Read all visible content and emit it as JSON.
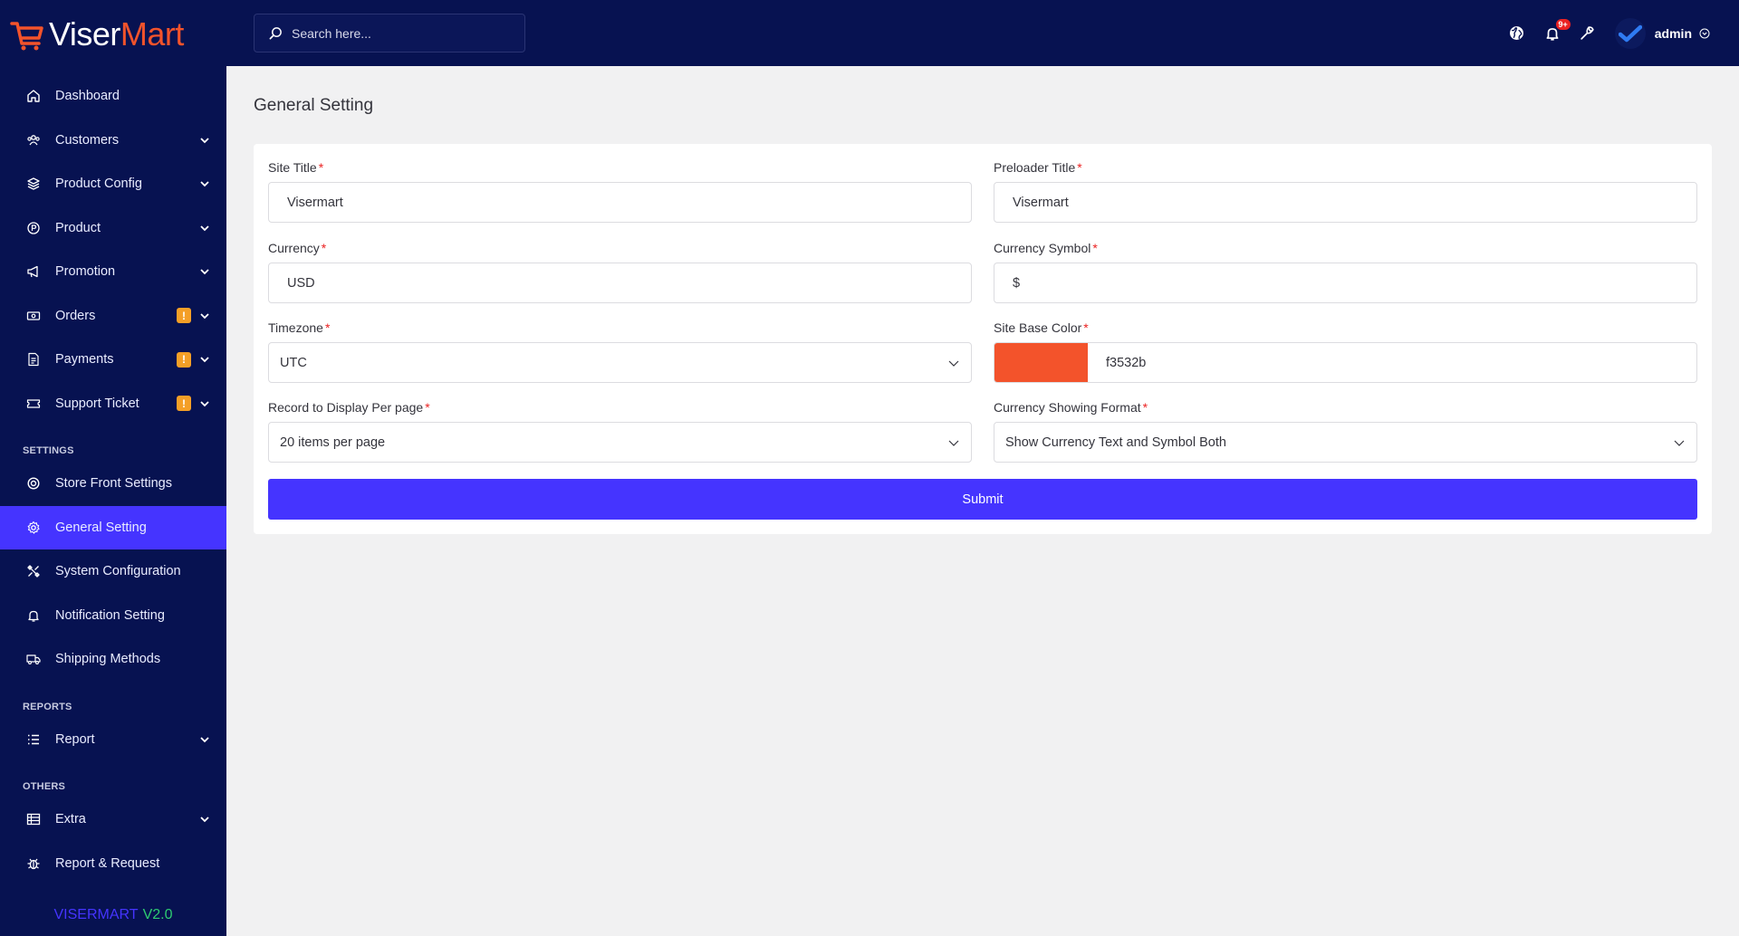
{
  "brand": {
    "logo_part1": "Viser",
    "logo_part2": "Mart",
    "version_name": "VISERMART",
    "version_number": "V2.0",
    "accent": "#4534ff",
    "brand_orange": "#f3532b",
    "sidebar_bg": "#071251"
  },
  "topbar": {
    "search_placeholder": "Search here...",
    "notification_count": "9+",
    "admin_name": "admin"
  },
  "sidebar": {
    "items": [
      {
        "label": "Dashboard",
        "icon": "home-icon"
      },
      {
        "label": "Customers",
        "icon": "users-icon",
        "has_submenu": true
      },
      {
        "label": "Product Config",
        "icon": "config-icon",
        "has_submenu": true
      },
      {
        "label": "Product",
        "icon": "product-icon",
        "has_submenu": true
      },
      {
        "label": "Promotion",
        "icon": "megaphone-icon",
        "has_submenu": true
      },
      {
        "label": "Orders",
        "icon": "money-icon",
        "has_submenu": true,
        "badge": "!"
      },
      {
        "label": "Payments",
        "icon": "invoice-icon",
        "has_submenu": true,
        "badge": "!"
      },
      {
        "label": "Support Ticket",
        "icon": "ticket-icon",
        "has_submenu": true,
        "badge": "!"
      }
    ],
    "settings_section": "SETTINGS",
    "settings_items": [
      {
        "label": "Store Front Settings",
        "icon": "circle-icon"
      },
      {
        "label": "General Setting",
        "icon": "gear-icon",
        "active": true
      },
      {
        "label": "System Configuration",
        "icon": "tools-icon"
      },
      {
        "label": "Notification Setting",
        "icon": "bell-icon"
      },
      {
        "label": "Shipping Methods",
        "icon": "truck-icon"
      }
    ],
    "reports_section": "REPORTS",
    "reports_items": [
      {
        "label": "Report",
        "icon": "list-icon",
        "has_submenu": true
      }
    ],
    "others_section": "OTHERS",
    "others_items": [
      {
        "label": "Extra",
        "icon": "table-icon",
        "has_submenu": true
      },
      {
        "label": "Report & Request",
        "icon": "bug-icon"
      }
    ]
  },
  "page": {
    "title": "General Setting"
  },
  "form": {
    "site_title": {
      "label": "Site Title",
      "value": "Visermart"
    },
    "preloader_title": {
      "label": "Preloader Title",
      "value": "Visermart"
    },
    "currency": {
      "label": "Currency",
      "value": "USD"
    },
    "currency_symbol": {
      "label": "Currency Symbol",
      "value": "$"
    },
    "timezone": {
      "label": "Timezone",
      "value": "UTC"
    },
    "site_base_color": {
      "label": "Site Base Color",
      "value": "f3532b",
      "swatch": "#f3532b"
    },
    "records_per_page": {
      "label": "Record to Display Per page",
      "value": "20 items per page"
    },
    "currency_format": {
      "label": "Currency Showing Format",
      "value": "Show Currency Text and Symbol Both"
    },
    "required_mark": "*",
    "submit_label": "Submit"
  }
}
